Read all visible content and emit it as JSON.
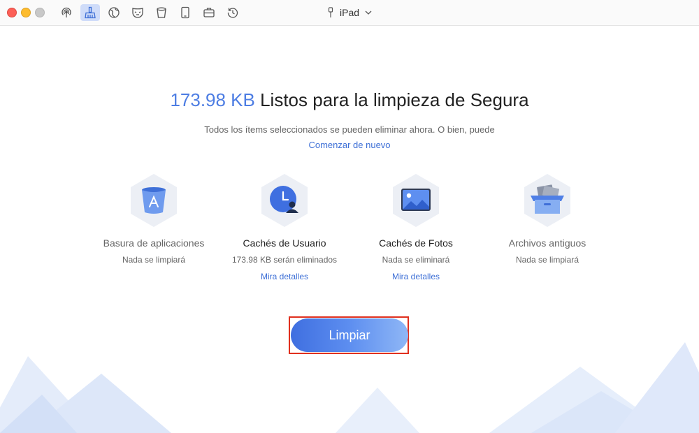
{
  "titlebar": {
    "tools": [
      {
        "icon": "airdrop-icon"
      },
      {
        "icon": "broom-icon",
        "active": true
      },
      {
        "icon": "globe-icon"
      },
      {
        "icon": "mask-icon"
      },
      {
        "icon": "trash-icon"
      },
      {
        "icon": "tablet-icon"
      },
      {
        "icon": "toolbox-icon"
      },
      {
        "icon": "history-icon"
      }
    ],
    "device_name": "iPad"
  },
  "headline": {
    "size": "173.98 KB",
    "text": " Listos para la limpieza de Segura"
  },
  "subtitle": "Todos los ítems seleccionados se pueden eliminar ahora. O bien, puede",
  "restart_link": "Comenzar de nuevo",
  "categories": [
    {
      "title": "Basura de aplicaciones",
      "status": "Nada se limpiará",
      "icon": "app-bin-icon"
    },
    {
      "title": "Cachés de Usuario",
      "status": "173.98 KB serán eliminados",
      "link": "Mira detalles",
      "icon": "user-clock-icon"
    },
    {
      "title": "Cachés de Fotos",
      "status": "Nada se eliminará",
      "link": "Mira detalles",
      "icon": "photo-icon"
    },
    {
      "title": "Archivos antiguos",
      "status": "Nada se limpiará",
      "icon": "archive-box-icon"
    }
  ],
  "clean_button": "Limpiar",
  "colors": {
    "accent": "#4d7de3",
    "highlight": "#e0301e"
  }
}
